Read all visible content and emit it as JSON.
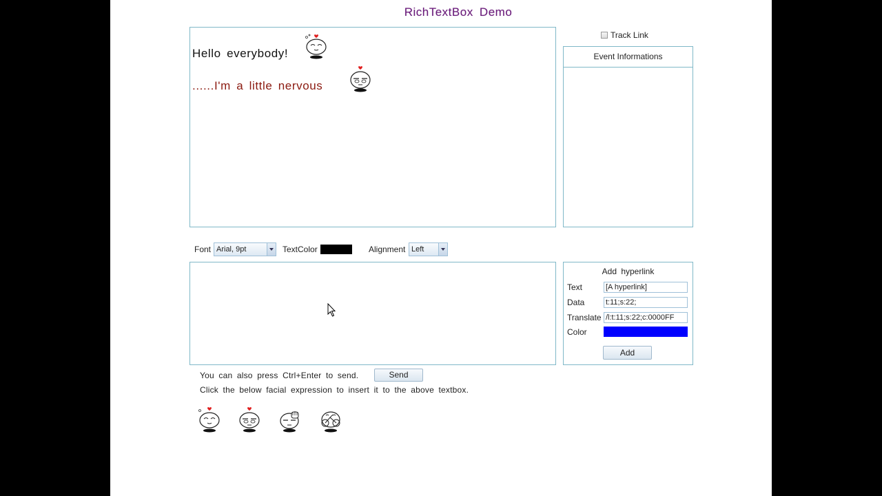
{
  "app": {
    "title": "RichTextBox Demo"
  },
  "display": {
    "messages": [
      {
        "text": "Hello everybody!",
        "color": "#111111",
        "emoticon": "smiling-face-icon"
      },
      {
        "text": "......I'm a little nervous",
        "color": "#8b1a10",
        "emoticon": "nervous-face-icon"
      }
    ]
  },
  "track_link": {
    "label": "Track Link",
    "checked": false
  },
  "event_panel": {
    "header": "Event Informations"
  },
  "toolbar": {
    "font_label": "Font",
    "font_value": "Arial, 9pt",
    "textcolor_label": "TextColor",
    "textcolor_value": "#000000",
    "alignment_label": "Alignment",
    "alignment_value": "Left"
  },
  "hyperlink": {
    "title": "Add hyperlink",
    "text_label": "Text",
    "text_value": "[A hyperlink]",
    "data_label": "Data",
    "data_value": "t:11;s:22;",
    "translate_label": "Translate",
    "translate_value": "/l:t:11;s:22;c:0000FF",
    "color_label": "Color",
    "color_value": "#0000FF",
    "add_label": "Add"
  },
  "send": {
    "hint": "You can also press Ctrl+Enter to send.",
    "button_label": "Send"
  },
  "emoticons": {
    "hint": "Click the below facial expression to insert it to the above textbox.",
    "items": [
      "smiling-face-icon",
      "nervous-face-icon",
      "waving-face-icon",
      "cycling-face-icon"
    ]
  }
}
